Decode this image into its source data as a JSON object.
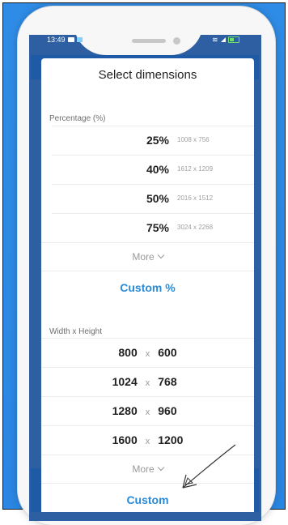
{
  "status": {
    "time": "13:49"
  },
  "dialog": {
    "title": "Select dimensions",
    "percentage": {
      "label": "Percentage (%)",
      "options": [
        {
          "percent": "25%",
          "dims": "1008 x 756"
        },
        {
          "percent": "40%",
          "dims": "1612 x 1209"
        },
        {
          "percent": "50%",
          "dims": "2016 x 1512"
        },
        {
          "percent": "75%",
          "dims": "3024 x 2268"
        }
      ],
      "more_label": "More",
      "custom_label": "Custom %"
    },
    "width_height": {
      "label": "Width x Height",
      "separator": "x",
      "options": [
        {
          "w": "800",
          "h": "600"
        },
        {
          "w": "1024",
          "h": "768"
        },
        {
          "w": "1280",
          "h": "960"
        },
        {
          "w": "1600",
          "h": "1200"
        }
      ],
      "more_label": "More",
      "custom_label": "Custom"
    }
  },
  "colors": {
    "accent": "#2a8ad6",
    "background": "#2f8ce6",
    "appbar": "#1f5aa6"
  }
}
